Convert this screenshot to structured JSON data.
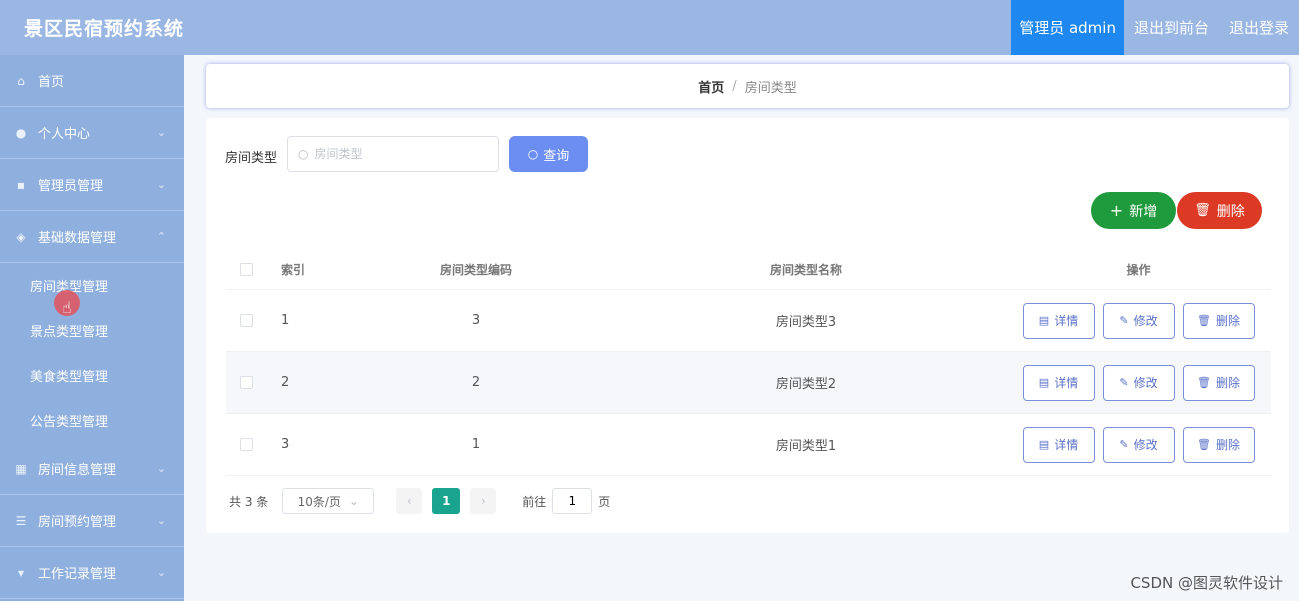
{
  "header": {
    "title": "景区民宿预约系统",
    "user_label": "管理员 admin",
    "front_link": "退出到前台",
    "logout_link": "退出登录"
  },
  "sidebar": {
    "items": [
      {
        "label": "首页",
        "icon": "home-icon"
      },
      {
        "label": "个人中心",
        "icon": "user-icon"
      },
      {
        "label": "管理员管理",
        "icon": "admin-icon"
      },
      {
        "label": "基础数据管理",
        "icon": "shield-icon"
      }
    ],
    "sub_items": [
      {
        "label": "房间类型管理"
      },
      {
        "label": "景点类型管理"
      },
      {
        "label": "美食类型管理"
      },
      {
        "label": "公告类型管理"
      }
    ],
    "items_after": [
      {
        "label": "房间信息管理",
        "icon": "grid-icon"
      },
      {
        "label": "房间预约管理",
        "icon": "list-icon"
      },
      {
        "label": "工作记录管理",
        "icon": "folder-icon"
      }
    ]
  },
  "breadcrumb": {
    "home": "首页",
    "separator": "/",
    "current": "房间类型"
  },
  "search": {
    "label": "房间类型",
    "placeholder": "房间类型",
    "button": "查询"
  },
  "actions": {
    "add": "新增",
    "delete": "删除"
  },
  "table": {
    "headers": [
      "索引",
      "房间类型编码",
      "房间类型名称",
      "操作"
    ],
    "rows": [
      {
        "index": "1",
        "code": "3",
        "name": "房间类型3"
      },
      {
        "index": "2",
        "code": "2",
        "name": "房间类型2"
      },
      {
        "index": "3",
        "code": "1",
        "name": "房间类型1"
      }
    ],
    "row_actions": {
      "detail": "详情",
      "edit": "修改",
      "delete": "删除"
    }
  },
  "pagination": {
    "total": "共 3 条",
    "page_size": "10条/页",
    "current_page": "1",
    "jump_label": "前往",
    "jump_value": "1",
    "jump_suffix": "页"
  },
  "watermark": "CSDN @图灵软件设计",
  "colors": {
    "header_bg": "#9ab7e3",
    "sidebar_bg": "#8fb0de",
    "user_bg": "#1e88f0",
    "query_btn": "#6c8ef2",
    "add_btn": "#1f9a3d",
    "delete_btn": "#dd3a26",
    "page_active": "#19a48d"
  }
}
